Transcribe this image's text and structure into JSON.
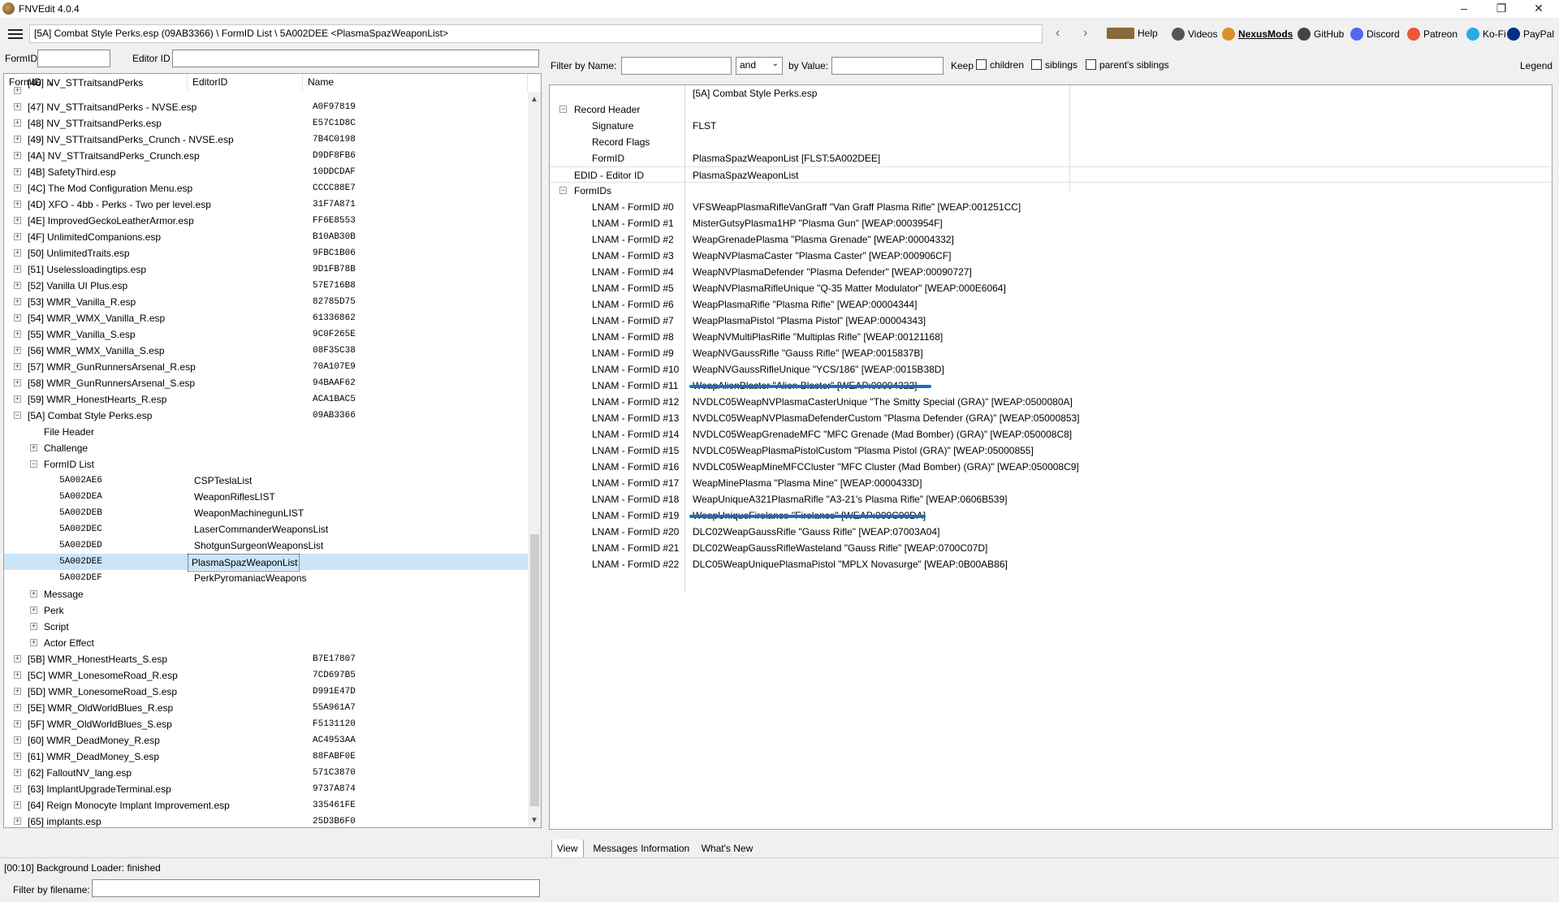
{
  "window": {
    "title": "FNVEdit 4.0.4",
    "minimize": "–",
    "maximize": "❐",
    "close": "✕"
  },
  "toolbar": {
    "path": "[5A] Combat Style Perks.esp (09AB3366) \\ FormID List \\ 5A002DEE <PlasmaSpazWeaponList>",
    "back": "‹",
    "forward": "›",
    "links": [
      {
        "label": "Help",
        "icon": "book-icon",
        "color": "#8a6a3a"
      },
      {
        "label": "Videos",
        "icon": "film-icon",
        "color": "#555555"
      },
      {
        "label": "NexusMods",
        "icon": "nexus-icon",
        "color": "#d98f2b"
      },
      {
        "label": "GitHub",
        "icon": "github-icon",
        "color": "#444444"
      },
      {
        "label": "Discord",
        "icon": "discord-icon",
        "color": "#5865f2"
      },
      {
        "label": "Patreon",
        "icon": "patreon-icon",
        "color": "#e8593a"
      },
      {
        "label": "Ko-Fi",
        "icon": "kofi-icon",
        "color": "#29abe0"
      },
      {
        "label": "PayPal",
        "icon": "paypal-icon",
        "color": "#003087"
      }
    ]
  },
  "left": {
    "formid_label": "FormID",
    "editorid_label": "Editor ID",
    "columns": [
      "FormID",
      "EditorID",
      "Name"
    ],
    "sort_arrow": "▲",
    "filter_label": "Filter by filename:",
    "rows": [
      {
        "level": 0,
        "exp": "+",
        "text": "[46] NV_STTraitsandPerks",
        "id": "",
        "partial": true
      },
      {
        "level": 0,
        "exp": "+",
        "text": "[47] NV_STTraitsandPerks - NVSE.esp",
        "id": "A0F97819"
      },
      {
        "level": 0,
        "exp": "+",
        "text": "[48] NV_STTraitsandPerks.esp",
        "id": "E57C1D8C"
      },
      {
        "level": 0,
        "exp": "+",
        "text": "[49] NV_STTraitsandPerks_Crunch - NVSE.esp",
        "id": "7B4C0198"
      },
      {
        "level": 0,
        "exp": "+",
        "text": "[4A] NV_STTraitsandPerks_Crunch.esp",
        "id": "D9DF8FB6"
      },
      {
        "level": 0,
        "exp": "+",
        "text": "[4B] SafetyThird.esp",
        "id": "10DDCDAF"
      },
      {
        "level": 0,
        "exp": "+",
        "text": "[4C] The Mod Configuration Menu.esp",
        "id": "CCCC88E7"
      },
      {
        "level": 0,
        "exp": "+",
        "text": "[4D] XFO - 4bb - Perks - Two per level.esp",
        "id": "31F7A871"
      },
      {
        "level": 0,
        "exp": "+",
        "text": "[4E] ImprovedGeckoLeatherArmor.esp",
        "id": "FF6E8553"
      },
      {
        "level": 0,
        "exp": "+",
        "text": "[4F] UnlimitedCompanions.esp",
        "id": "B10AB30B"
      },
      {
        "level": 0,
        "exp": "+",
        "text": "[50] UnlimitedTraits.esp",
        "id": "9FBC1B06"
      },
      {
        "level": 0,
        "exp": "+",
        "text": "[51] Uselessloadingtips.esp",
        "id": "9D1FB78B"
      },
      {
        "level": 0,
        "exp": "+",
        "text": "[52] Vanilla UI Plus.esp",
        "id": "57E716B8"
      },
      {
        "level": 0,
        "exp": "+",
        "text": "[53] WMR_Vanilla_R.esp",
        "id": "82785D75"
      },
      {
        "level": 0,
        "exp": "+",
        "text": "[54] WMR_WMX_Vanilla_R.esp",
        "id": "61336862"
      },
      {
        "level": 0,
        "exp": "+",
        "text": "[55] WMR_Vanilla_S.esp",
        "id": "9C0F265E"
      },
      {
        "level": 0,
        "exp": "+",
        "text": "[56] WMR_WMX_Vanilla_S.esp",
        "id": "08F35C38"
      },
      {
        "level": 0,
        "exp": "+",
        "text": "[57] WMR_GunRunnersArsenal_R.esp",
        "id": "70A107E9"
      },
      {
        "level": 0,
        "exp": "+",
        "text": "[58] WMR_GunRunnersArsenal_S.esp",
        "id": "94BAAF62"
      },
      {
        "level": 0,
        "exp": "+",
        "text": "[59] WMR_HonestHearts_R.esp",
        "id": "ACA1BAC5"
      },
      {
        "level": 0,
        "exp": "-",
        "text": "[5A] Combat Style Perks.esp",
        "id": "09AB3366"
      },
      {
        "level": 1,
        "exp": "",
        "text": "File Header",
        "id": ""
      },
      {
        "level": 1,
        "exp": "+",
        "text": "Challenge",
        "id": ""
      },
      {
        "level": 1,
        "exp": "-",
        "text": "FormID List",
        "id": ""
      },
      {
        "level": 2,
        "exp": "",
        "text": "5A002AE6",
        "edid": "CSPTeslaList",
        "mono": true
      },
      {
        "level": 2,
        "exp": "",
        "text": "5A002DEA",
        "edid": "WeaponRiflesLIST",
        "mono": true
      },
      {
        "level": 2,
        "exp": "",
        "text": "5A002DEB",
        "edid": "WeaponMachinegunLIST",
        "mono": true
      },
      {
        "level": 2,
        "exp": "",
        "text": "5A002DEC",
        "edid": "LaserCommanderWeaponsList",
        "mono": true
      },
      {
        "level": 2,
        "exp": "",
        "text": "5A002DED",
        "edid": "ShotgunSurgeonWeaponsList",
        "mono": true
      },
      {
        "level": 2,
        "exp": "",
        "text": "5A002DEE",
        "edid": "PlasmaSpazWeaponList",
        "mono": true,
        "selected": true
      },
      {
        "level": 2,
        "exp": "",
        "text": "5A002DEF",
        "edid": "PerkPyromaniacWeapons",
        "mono": true
      },
      {
        "level": 1,
        "exp": "+",
        "text": "Message",
        "id": ""
      },
      {
        "level": 1,
        "exp": "+",
        "text": "Perk",
        "id": ""
      },
      {
        "level": 1,
        "exp": "+",
        "text": "Script",
        "id": ""
      },
      {
        "level": 1,
        "exp": "+",
        "text": "Actor Effect",
        "id": ""
      },
      {
        "level": 0,
        "exp": "+",
        "text": "[5B] WMR_HonestHearts_S.esp",
        "id": "B7E17807"
      },
      {
        "level": 0,
        "exp": "+",
        "text": "[5C] WMR_LonesomeRoad_R.esp",
        "id": "7CD697B5"
      },
      {
        "level": 0,
        "exp": "+",
        "text": "[5D] WMR_LonesomeRoad_S.esp",
        "id": "D991E47D"
      },
      {
        "level": 0,
        "exp": "+",
        "text": "[5E] WMR_OldWorldBlues_R.esp",
        "id": "55A961A7"
      },
      {
        "level": 0,
        "exp": "+",
        "text": "[5F] WMR_OldWorldBlues_S.esp",
        "id": "F5131120"
      },
      {
        "level": 0,
        "exp": "+",
        "text": "[60] WMR_DeadMoney_R.esp",
        "id": "AC4953AA"
      },
      {
        "level": 0,
        "exp": "+",
        "text": "[61] WMR_DeadMoney_S.esp",
        "id": "88FABF0E"
      },
      {
        "level": 0,
        "exp": "+",
        "text": "[62] FalloutNV_lang.esp",
        "id": "571C3870"
      },
      {
        "level": 0,
        "exp": "+",
        "text": "[63] ImplantUpgradeTerminal.esp",
        "id": "9737A874"
      },
      {
        "level": 0,
        "exp": "+",
        "text": "[64] Reign Monocyte Implant Improvement.esp",
        "id": "335461FE"
      },
      {
        "level": 0,
        "exp": "+",
        "text": "[65] implants.esp",
        "id": "25D3B6F0"
      }
    ]
  },
  "right": {
    "filter_name_label": "Filter by Name:",
    "and_value": "and",
    "by_value_label": "by Value:",
    "keep_label": "Keep",
    "children_label": "children",
    "siblings_label": "siblings",
    "parents_siblings_label": "parent's siblings",
    "legend_label": "Legend",
    "header_file": "[5A] Combat Style Perks.esp",
    "record_rows": [
      {
        "level": 0,
        "exp": "-",
        "key": "Record Header",
        "value": ""
      },
      {
        "level": 1,
        "exp": "",
        "key": "Signature",
        "value": "FLST"
      },
      {
        "level": 1,
        "exp": "",
        "key": "Record Flags",
        "value": ""
      },
      {
        "level": 1,
        "exp": "",
        "key": "FormID",
        "value": "PlasmaSpazWeaponList [FLST:5A002DEE]"
      },
      {
        "level": 0,
        "exp": "",
        "key": "EDID - Editor ID",
        "value": "PlasmaSpazWeaponList"
      },
      {
        "level": 0,
        "exp": "-",
        "key": "FormIDs",
        "value": ""
      },
      {
        "level": 1,
        "exp": "",
        "key": "LNAM - FormID #0",
        "value": "VFSWeapPlasmaRifleVanGraff \"Van Graff Plasma Rifle\" [WEAP:001251CC]"
      },
      {
        "level": 1,
        "exp": "",
        "key": "LNAM - FormID #1",
        "value": "MisterGutsyPlasma1HP \"Plasma Gun\" [WEAP:0003954F]"
      },
      {
        "level": 1,
        "exp": "",
        "key": "LNAM - FormID #2",
        "value": "WeapGrenadePlasma \"Plasma Grenade\" [WEAP:00004332]"
      },
      {
        "level": 1,
        "exp": "",
        "key": "LNAM - FormID #3",
        "value": "WeapNVPlasmaCaster \"Plasma Caster\" [WEAP:000906CF]"
      },
      {
        "level": 1,
        "exp": "",
        "key": "LNAM - FormID #4",
        "value": "WeapNVPlasmaDefender \"Plasma Defender\" [WEAP:00090727]"
      },
      {
        "level": 1,
        "exp": "",
        "key": "LNAM - FormID #5",
        "value": "WeapNVPlasmaRifleUnique \"Q-35 Matter Modulator\" [WEAP:000E6064]"
      },
      {
        "level": 1,
        "exp": "",
        "key": "LNAM - FormID #6",
        "value": "WeapPlasmaRifle \"Plasma Rifle\" [WEAP:00004344]"
      },
      {
        "level": 1,
        "exp": "",
        "key": "LNAM - FormID #7",
        "value": "WeapPlasmaPistol \"Plasma Pistol\" [WEAP:00004343]"
      },
      {
        "level": 1,
        "exp": "",
        "key": "LNAM - FormID #8",
        "value": "WeapNVMultiPlasRifle \"Multiplas Rifle\" [WEAP:00121168]"
      },
      {
        "level": 1,
        "exp": "",
        "key": "LNAM - FormID #9",
        "value": "WeapNVGaussRifle \"Gauss Rifle\" [WEAP:0015837B]"
      },
      {
        "level": 1,
        "exp": "",
        "key": "LNAM - FormID #10",
        "value": "WeapNVGaussRifleUnique \"YCS/186\" [WEAP:0015B38D]"
      },
      {
        "level": 1,
        "exp": "",
        "key": "LNAM - FormID #11",
        "value": "WeapAlienBlaster \"Alien Blaster\" [WEAP:00004322]",
        "struck": true
      },
      {
        "level": 1,
        "exp": "",
        "key": "LNAM - FormID #12",
        "value": "NVDLC05WeapNVPlasmaCasterUnique \"The Smitty Special (GRA)\" [WEAP:0500080A]"
      },
      {
        "level": 1,
        "exp": "",
        "key": "LNAM - FormID #13",
        "value": "NVDLC05WeapNVPlasmaDefenderCustom \"Plasma Defender (GRA)\" [WEAP:05000853]"
      },
      {
        "level": 1,
        "exp": "",
        "key": "LNAM - FormID #14",
        "value": "NVDLC05WeapGrenadeMFC \"MFC Grenade (Mad Bomber) (GRA)\" [WEAP:050008C8]"
      },
      {
        "level": 1,
        "exp": "",
        "key": "LNAM - FormID #15",
        "value": "NVDLC05WeapPlasmaPistolCustom \"Plasma Pistol (GRA)\" [WEAP:05000855]"
      },
      {
        "level": 1,
        "exp": "",
        "key": "LNAM - FormID #16",
        "value": "NVDLC05WeapMineMFCCluster \"MFC Cluster (Mad Bomber) (GRA)\" [WEAP:050008C9]"
      },
      {
        "level": 1,
        "exp": "",
        "key": "LNAM - FormID #17",
        "value": "WeapMinePlasma \"Plasma Mine\" [WEAP:0000433D]"
      },
      {
        "level": 1,
        "exp": "",
        "key": "LNAM - FormID #18",
        "value": "WeapUniqueA321PlasmaRifle \"A3-21's Plasma Rifle\" [WEAP:0606B539]"
      },
      {
        "level": 1,
        "exp": "",
        "key": "LNAM - FormID #19",
        "value": "WeapUniqueFirelance \"Firelance\" [WEAP:000C00DA]",
        "struck": true
      },
      {
        "level": 1,
        "exp": "",
        "key": "LNAM - FormID #20",
        "value": "DLC02WeapGaussRifle \"Gauss Rifle\" [WEAP:07003A04]"
      },
      {
        "level": 1,
        "exp": "",
        "key": "LNAM - FormID #21",
        "value": "DLC02WeapGaussRifleWasteland \"Gauss Rifle\" [WEAP:0700C07D]"
      },
      {
        "level": 1,
        "exp": "",
        "key": "LNAM - FormID #22",
        "value": "DLC05WeapUniquePlasmaPistol \"MPLX Novasurge\" [WEAP:0B00AB86]"
      }
    ],
    "tabs": [
      "View",
      "Messages",
      "Information",
      "What's New"
    ],
    "strike_color": "#1a6fc4"
  },
  "status": {
    "text": "[00:10] Background Loader: finished"
  }
}
